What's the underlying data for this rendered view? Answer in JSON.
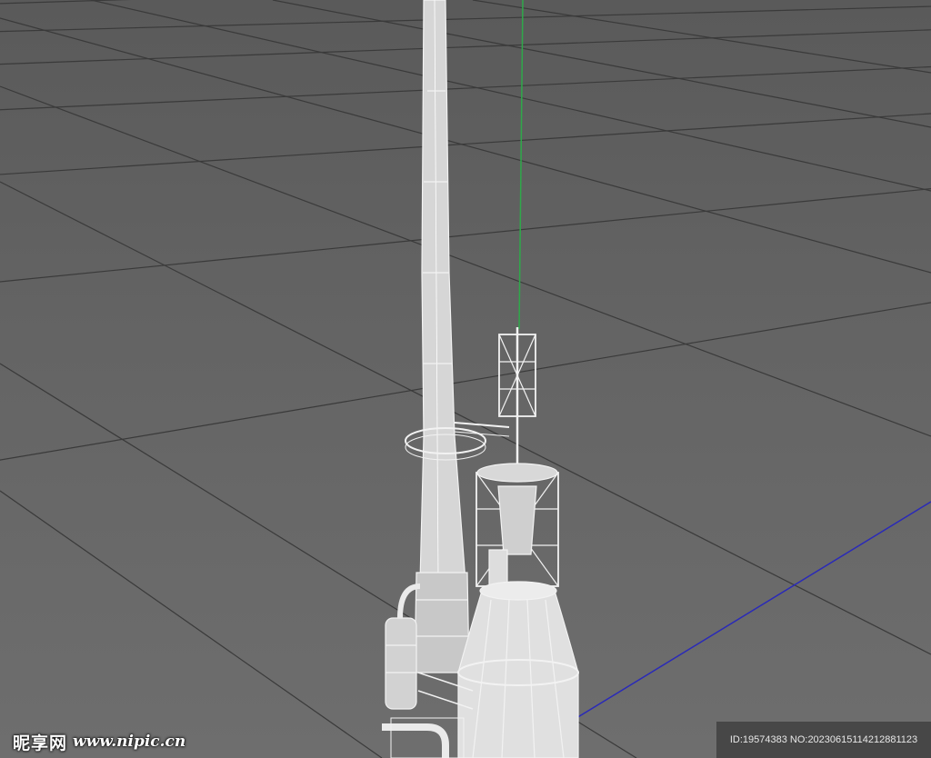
{
  "viewport": {
    "background_top": "#5a5a5a",
    "background_bottom": "#6e6e6e",
    "grid_color": "#3a3a3a",
    "y_axis_color": "#2fa84a",
    "z_axis_color": "#2a2ab8",
    "model_stroke": "#f2f2f2",
    "model_fill": "#d9d9d9"
  },
  "watermark": {
    "logo_cn": "昵享网",
    "logo_url": "www.nipic.cn",
    "id_text": "ID:19574383 NO:20230615114212881123"
  }
}
